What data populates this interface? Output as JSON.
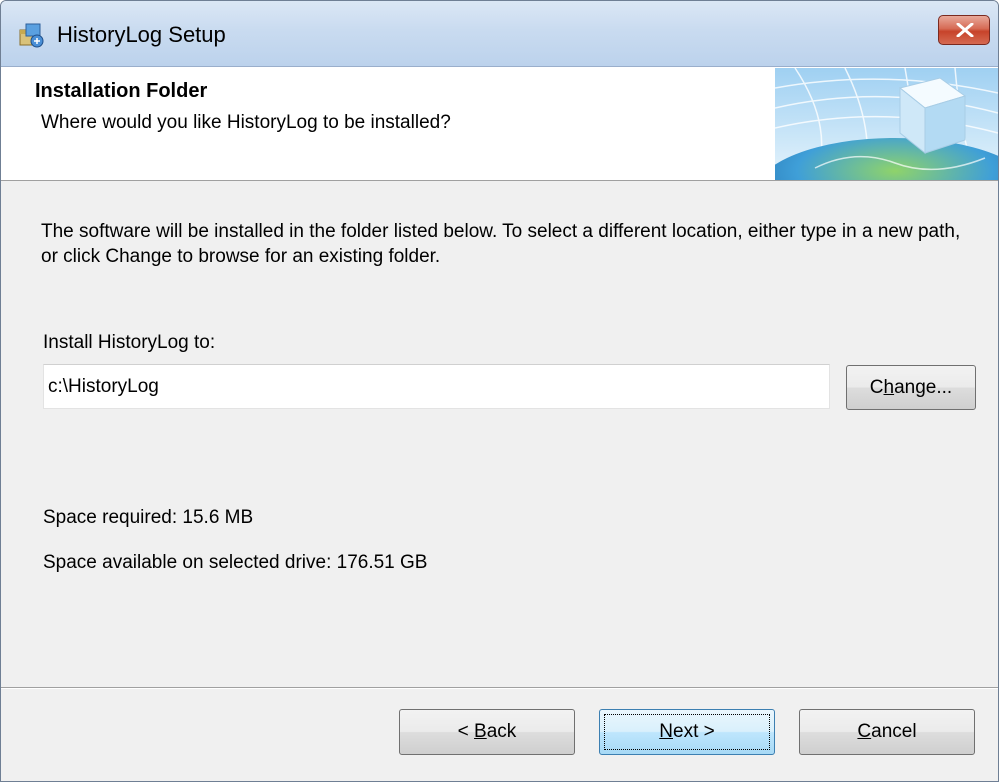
{
  "window": {
    "title": "HistoryLog Setup"
  },
  "header": {
    "title": "Installation Folder",
    "subtitle": "Where would you like HistoryLog to be installed?"
  },
  "main": {
    "description": "The software will be installed in the folder listed below. To select a different location, either type in a new path, or click Change to browse for an existing folder.",
    "install_label": "Install HistoryLog to:",
    "install_path": "c:\\HistoryLog",
    "change_button": {
      "before": "C",
      "accel": "h",
      "after": "ange..."
    },
    "space_required": "Space required: 15.6 MB",
    "space_available": "Space available on selected drive: 176.51 GB"
  },
  "footer": {
    "back_button": {
      "before": "< ",
      "accel": "B",
      "after": "ack"
    },
    "next_button": {
      "before": "",
      "accel": "N",
      "after": "ext >"
    },
    "cancel_button": {
      "before": "",
      "accel": "C",
      "after": "ancel"
    }
  },
  "icons": {
    "app": "setup-package-icon",
    "close": "close-icon",
    "banner": "globe-cube-banner"
  },
  "colors": {
    "close_button": "#c7432a",
    "default_button_border": "#3c7fb1",
    "titlebar": "#c9dbf0"
  }
}
